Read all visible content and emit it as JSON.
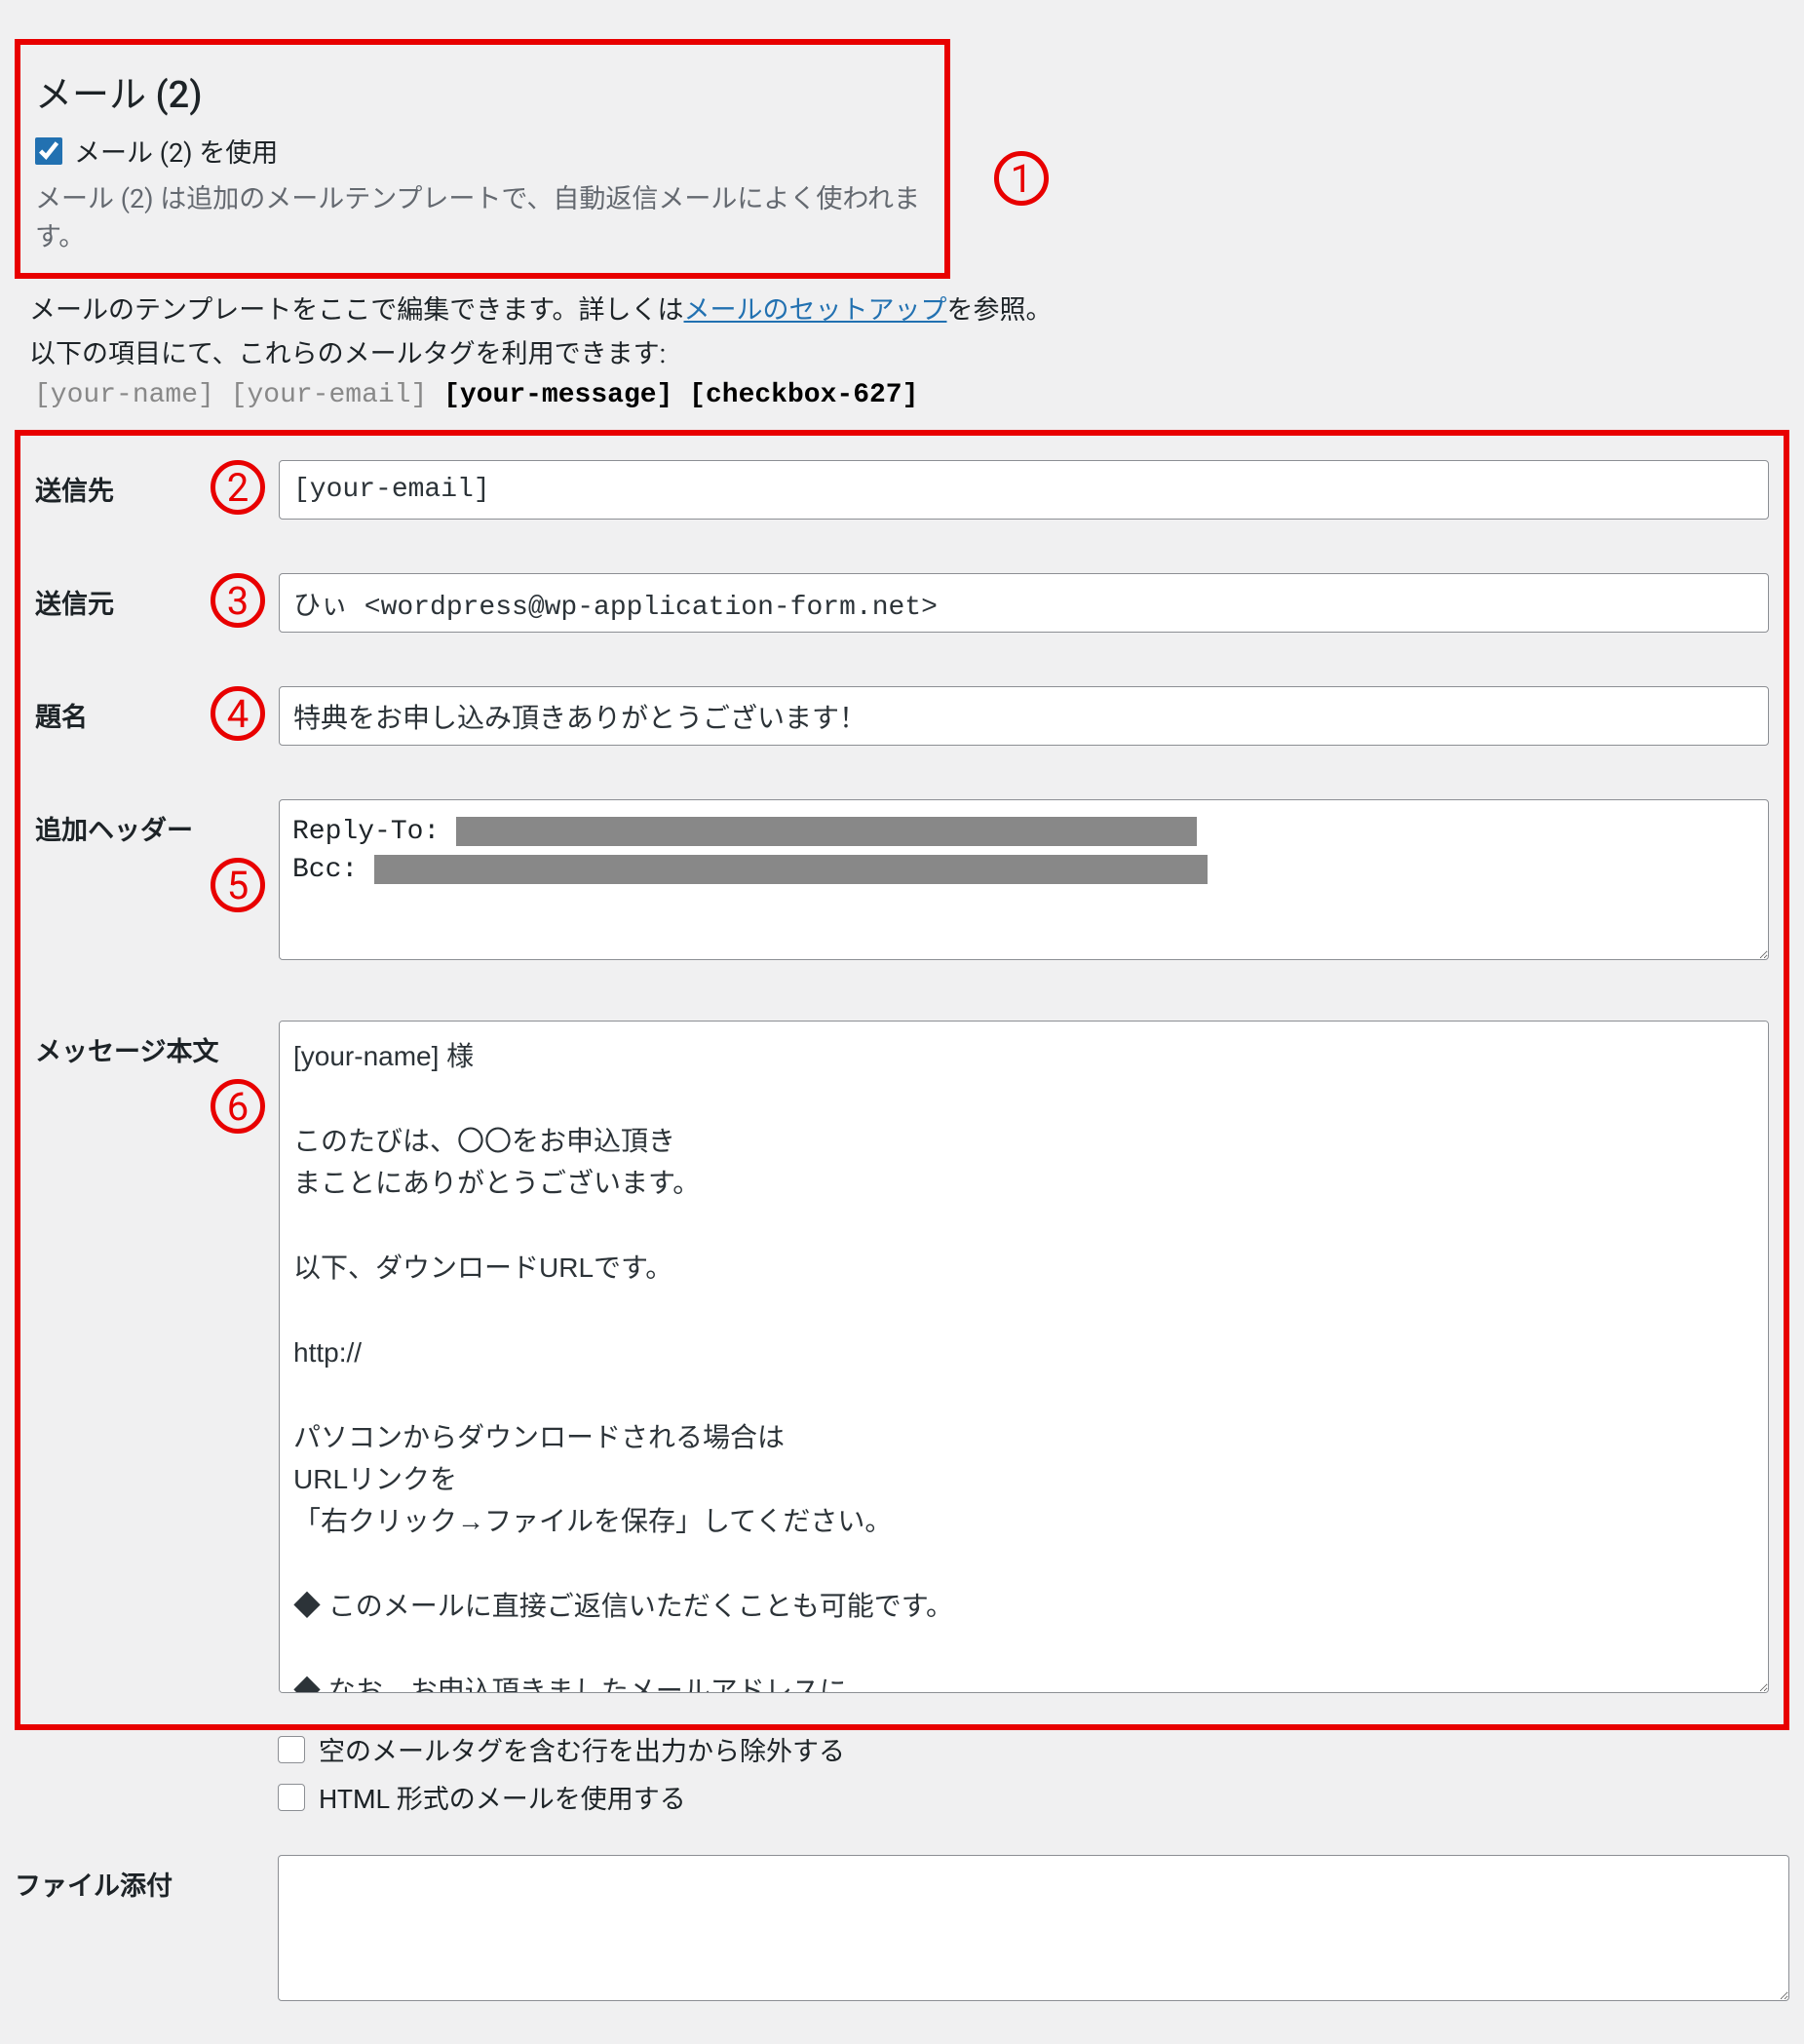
{
  "header": {
    "title": "メール (2)",
    "checkbox_label": "メール (2) を使用",
    "checkbox_checked": true,
    "desc": "メール (2) は追加のメールテンプレートで、自動返信メールによく使われます。"
  },
  "annotations": {
    "a1": "1",
    "a2": "2",
    "a3": "3",
    "a4": "4",
    "a5": "5",
    "a6": "6"
  },
  "template_info": {
    "prefix": "メールのテンプレートをここで編集できます。詳しくは",
    "link": "メールのセットアップ",
    "suffix": "を参照。",
    "tags_intro": "以下の項目にて、これらのメールタグを利用できます:"
  },
  "mail_tags": {
    "gray1": "[your-name]",
    "gray2": "[your-email]",
    "bold1": "[your-message]",
    "bold2": "[checkbox-627]"
  },
  "fields": {
    "to": {
      "label": "送信先",
      "value": "[your-email]"
    },
    "from": {
      "label": "送信元",
      "value": "ひぃ <wordpress@wp-application-form.net>"
    },
    "subject": {
      "label": "題名",
      "value": "特典をお申し込み頂きありがとうございます！"
    },
    "headers": {
      "label": "追加ヘッダー",
      "line1_label": "Reply-To:",
      "line2_label": "Bcc:"
    },
    "body": {
      "label": "メッセージ本文",
      "value": "[your-name] 様\n\nこのたびは、〇〇をお申込頂き\nまことにありがとうございます。\n\n以下、ダウンロードURLです。\n\nhttp://\n\nパソコンからダウンロードされる場合は\nURLリンクを\n「右クリック→ファイルを保存」してください。\n\n◆ このメールに直接ご返信いただくことも可能です。\n\n◆ なお、お申込頂きましたメールアドレスに\n後日、当社発行のメールマガジンを\n登録させていただきます。"
    },
    "options": {
      "exclude_blank": "空のメールタグを含む行を出力から除外する",
      "use_html": "HTML 形式のメールを使用する"
    },
    "attachments": {
      "label": "ファイル添付",
      "value": ""
    }
  }
}
